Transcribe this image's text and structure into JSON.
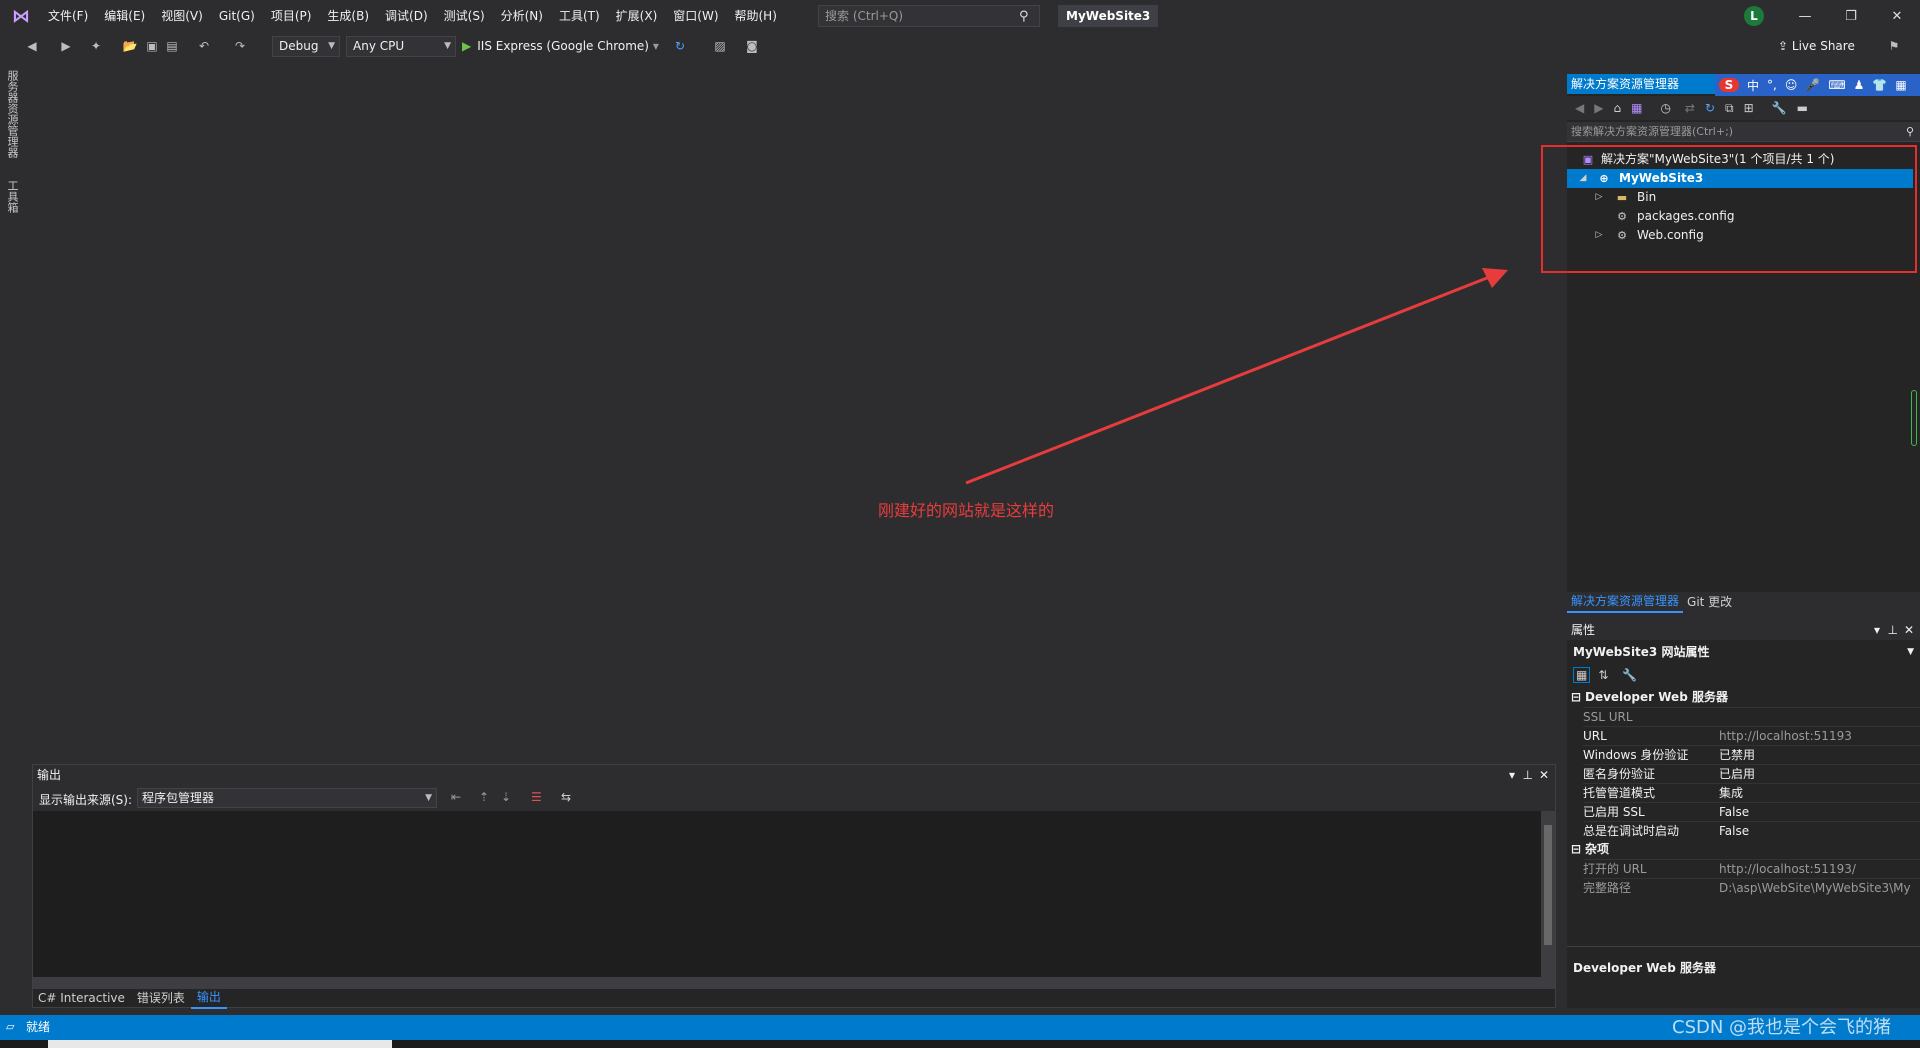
{
  "menu": {
    "items": [
      "文件(F)",
      "编辑(E)",
      "视图(V)",
      "Git(G)",
      "项目(P)",
      "生成(B)",
      "调试(D)",
      "测试(S)",
      "分析(N)",
      "工具(T)",
      "扩展(X)",
      "窗口(W)",
      "帮助(H)"
    ],
    "search_placeholder": "搜索 (Ctrl+Q)",
    "solution_name": "MyWebSite3",
    "avatar_letter": "L"
  },
  "toolbar": {
    "config": "Debug",
    "platform": "Any CPU",
    "run_label": "IIS Express (Google Chrome)",
    "live_share": "Live Share"
  },
  "left_tabs": [
    "服务器资源管理器",
    "工具箱"
  ],
  "annotation": "刚建好的网站就是这样的",
  "output": {
    "title": "输出",
    "source_label": "显示输出来源(S):",
    "source_value": "程序包管理器"
  },
  "bottom_tabs": [
    "C# Interactive",
    "错误列表",
    "输出"
  ],
  "solution_explorer": {
    "title": "解决方案资源管理器",
    "search_placeholder": "搜索解决方案资源管理器(Ctrl+;)",
    "tree": [
      {
        "label": "解决方案\"MyWebSite3\"(1 个项目/共 1 个)",
        "depth": 0,
        "caret": "",
        "icon": "solution-icon"
      },
      {
        "label": "MyWebSite3",
        "depth": 1,
        "caret": "◢",
        "icon": "globe-icon",
        "selected": true
      },
      {
        "label": "Bin",
        "depth": 2,
        "caret": "▷",
        "icon": "folder-icon"
      },
      {
        "label": "packages.config",
        "depth": 2,
        "caret": "",
        "icon": "config-file-icon"
      },
      {
        "label": "Web.config",
        "depth": 2,
        "caret": "▷",
        "icon": "config-file-icon"
      }
    ],
    "tabs": [
      "解决方案资源管理器",
      "Git 更改"
    ]
  },
  "properties": {
    "title": "属性",
    "object": "MyWebSite3 网站属性",
    "categories": [
      {
        "name": "Developer Web 服务器",
        "rows": [
          {
            "name": "SSL URL",
            "value": "",
            "dim": true
          },
          {
            "name": "URL",
            "value": "http://localhost:51193",
            "dim": true
          },
          {
            "name": "Windows 身份验证",
            "value": "已禁用"
          },
          {
            "name": "匿名身份验证",
            "value": "已启用"
          },
          {
            "name": "托管管道模式",
            "value": "集成"
          },
          {
            "name": "已启用 SSL",
            "value": "False"
          },
          {
            "name": "总是在调试时启动",
            "value": "False"
          }
        ]
      },
      {
        "name": "杂项",
        "rows": [
          {
            "name": "打开的 URL",
            "value": "http://localhost:51193/",
            "dim": true
          },
          {
            "name": "完整路径",
            "value": "D:\\asp\\WebSite\\MyWebSite3\\My",
            "dim": true
          }
        ]
      }
    ],
    "description": "Developer Web 服务器"
  },
  "status": {
    "text": "就绪",
    "watermark": "CSDN @我也是个会飞的猪"
  },
  "colors": {
    "accent": "#007acc",
    "annotation": "#e83c3c",
    "selected": "#007acc"
  }
}
